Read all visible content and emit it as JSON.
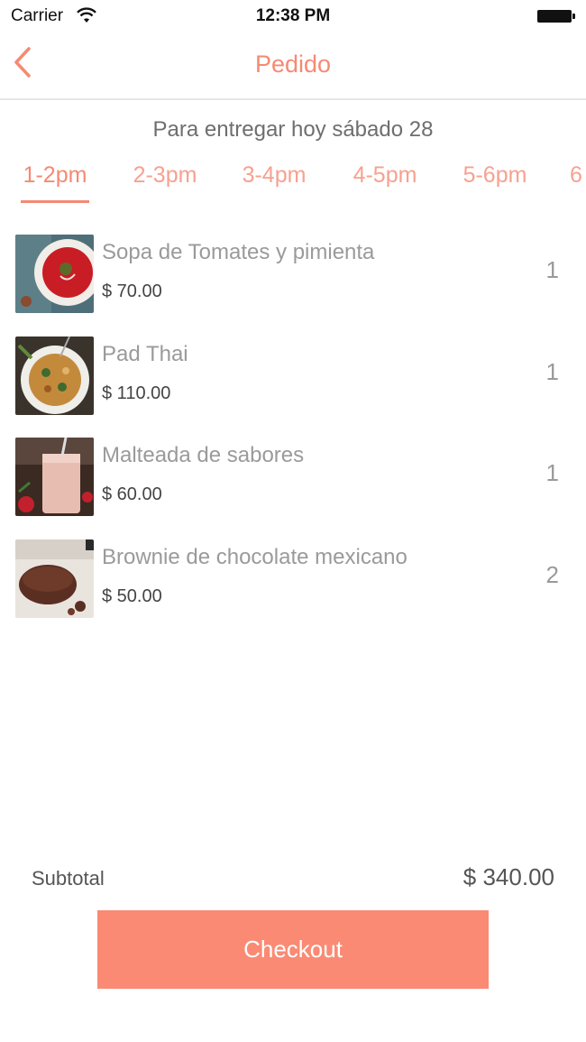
{
  "status_bar": {
    "carrier": "Carrier",
    "time": "12:38 PM"
  },
  "nav": {
    "title": "Pedido",
    "back_icon": "chevron-left-icon"
  },
  "delivery": {
    "label": "Para entregar hoy sábado 28"
  },
  "time_slots": [
    {
      "label": "1-2pm",
      "selected": true
    },
    {
      "label": "2-3pm",
      "selected": false
    },
    {
      "label": "3-4pm",
      "selected": false
    },
    {
      "label": "4-5pm",
      "selected": false
    },
    {
      "label": "5-6pm",
      "selected": false
    },
    {
      "label": "6",
      "selected": false
    }
  ],
  "order_items": [
    {
      "name": "Sopa de Tomates y pimienta",
      "price": "$ 70.00",
      "quantity": "1"
    },
    {
      "name": "Pad Thai",
      "price": "$ 110.00",
      "quantity": "1"
    },
    {
      "name": "Malteada de sabores",
      "price": "$ 60.00",
      "quantity": "1"
    },
    {
      "name": "Brownie de chocolate mexicano",
      "price": "$ 50.00",
      "quantity": "2"
    }
  ],
  "summary": {
    "subtotal_label": "Subtotal",
    "subtotal_value": "$ 340.00"
  },
  "checkout": {
    "label": "Checkout"
  },
  "colors": {
    "accent": "#f58a73",
    "button": "#fa8a74"
  }
}
